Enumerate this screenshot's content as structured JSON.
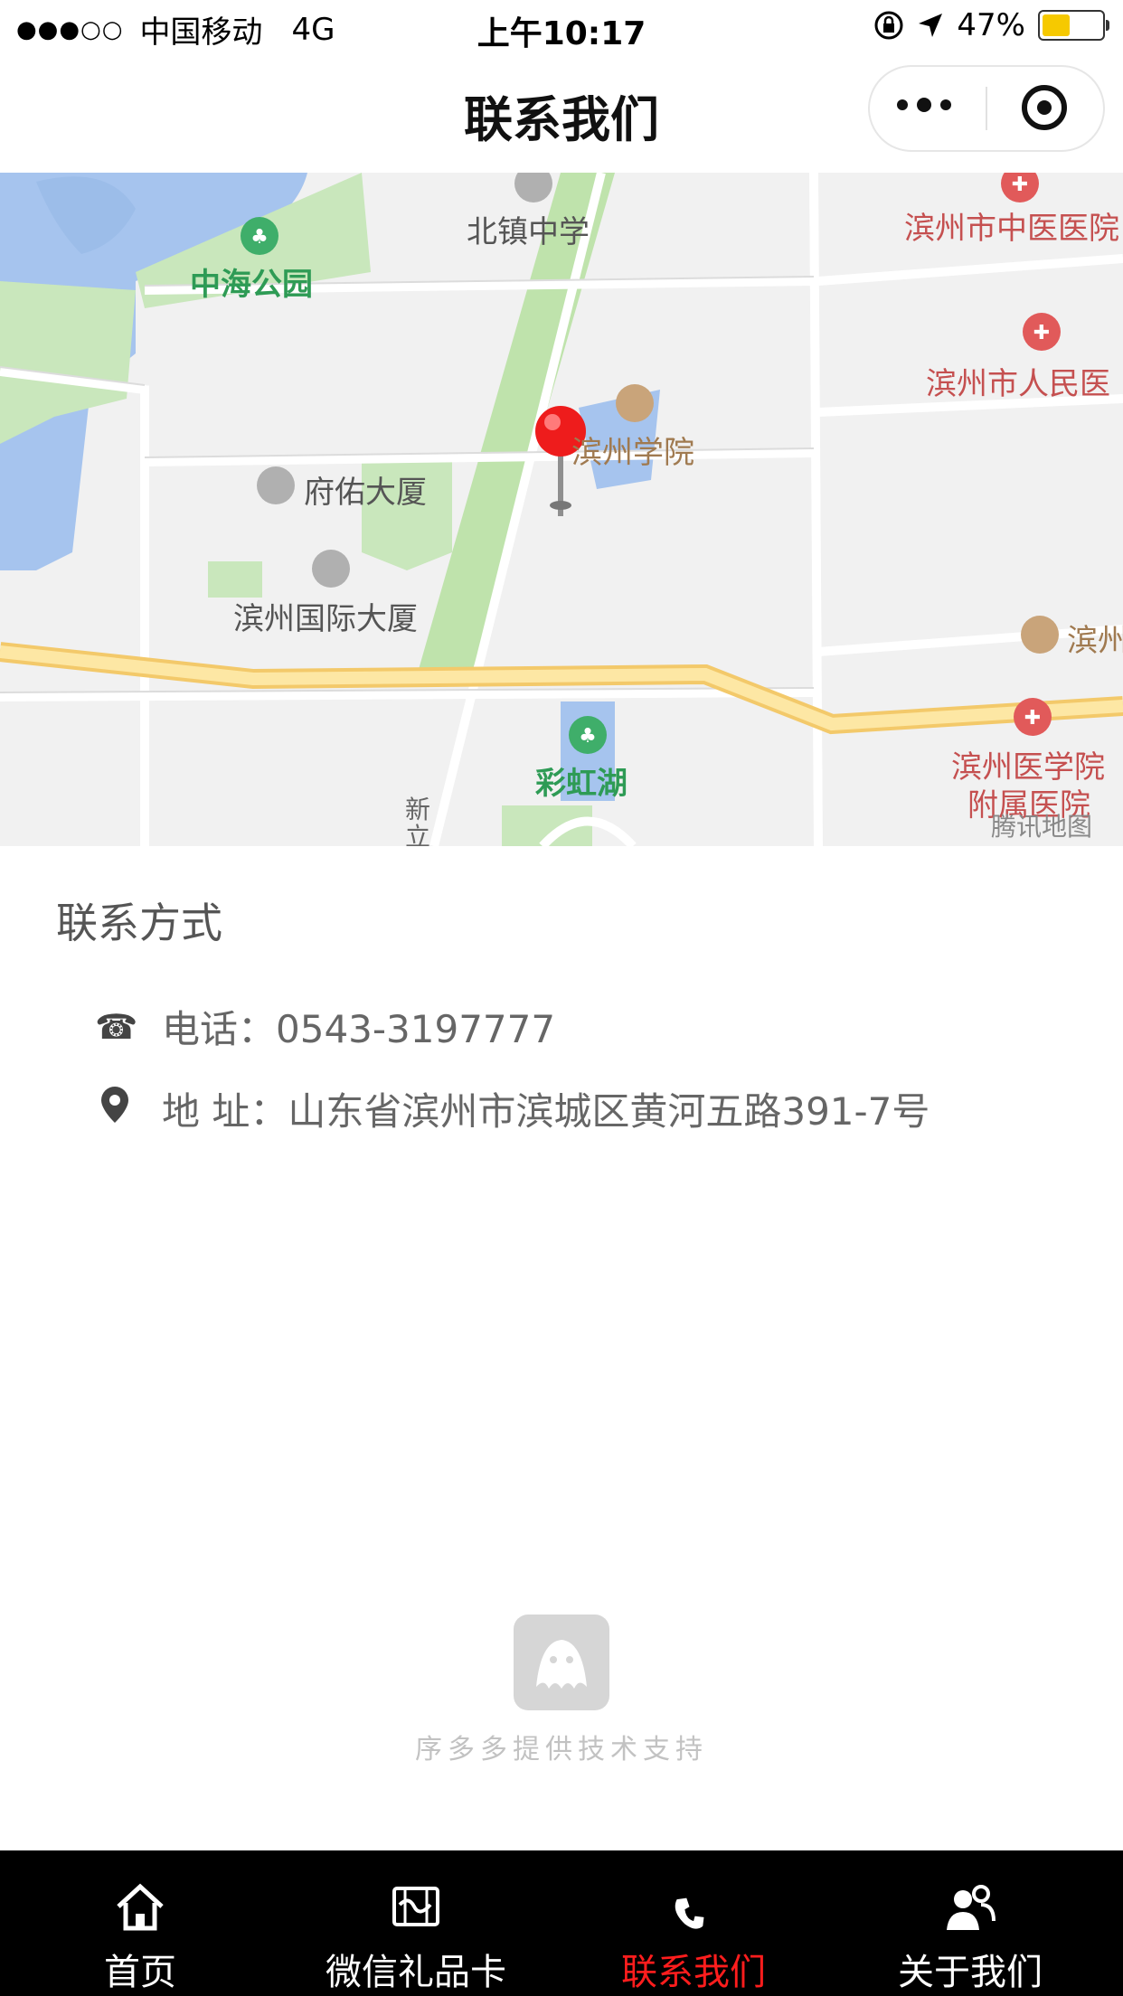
{
  "status_bar": {
    "carrier": "中国移动",
    "network": "4G",
    "time": "上午10:17",
    "battery": "47%",
    "battery_level": 0.47
  },
  "nav": {
    "title": "联系我们"
  },
  "map": {
    "labels": {
      "zhonghai_park": "中海公园",
      "beizhen_school": "北镇中学",
      "tcm_hospital": "滨州市中医医院",
      "peoples_hospital": "滨州市人民医",
      "binzhou_college": "滨州学院",
      "fuyou_building": "府佑大厦",
      "intl_building": "滨州国际大厦",
      "binzhou_right": "滨州",
      "rainbow_lake": "彩虹湖",
      "medical_college": "滨州医学院",
      "affiliated_hospital": "附属医院",
      "road_xin": "新立",
      "watermark": "腾讯地图"
    }
  },
  "contact": {
    "section_title": "联系方式",
    "phone_text": "电话：0543-3197777",
    "address_text": "地 址：山东省滨州市滨城区黄河五路391-7号",
    "phone_icon": "☎"
  },
  "brand": {
    "text": "序多多提供技术支持"
  },
  "tabbar": {
    "tabs": [
      {
        "label": "首页"
      },
      {
        "label": "微信礼品卡"
      },
      {
        "label": "联系我们"
      },
      {
        "label": "关于我们"
      }
    ],
    "active_color": "#ff1d1d"
  }
}
